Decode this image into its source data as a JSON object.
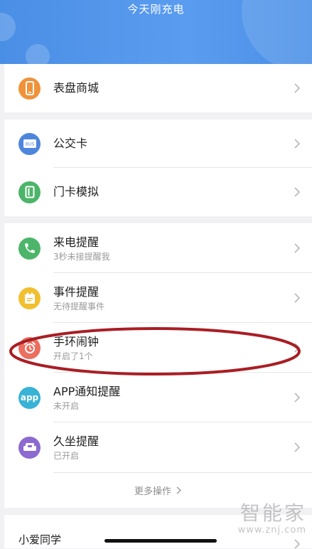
{
  "header": {
    "title": "今天刚充电"
  },
  "colors": {
    "header_bg": "#4a8fe6",
    "orange": "#f0923a",
    "blue": "#4d86dc",
    "green": "#4cb56a",
    "yellow": "#f2bf2f",
    "red": "#ec6e5f",
    "teal": "#38b3d6",
    "purple": "#8c6ad0",
    "annotation": "#a91e24"
  },
  "groups": [
    {
      "items": [
        {
          "label": "表盘商城",
          "icon": "watch-face-store-icon"
        }
      ]
    },
    {
      "items": [
        {
          "label": "公交卡",
          "icon": "bus-card-icon"
        },
        {
          "label": "门卡模拟",
          "icon": "door-card-icon"
        }
      ]
    },
    {
      "items": [
        {
          "label": "来电提醒",
          "sub": "3秒未接提醒我",
          "icon": "phone-icon"
        },
        {
          "label": "事件提醒",
          "sub": "无待提醒事件",
          "icon": "calendar-icon"
        },
        {
          "label": "手环闹钟",
          "sub": "开启了1个",
          "icon": "alarm-clock-icon"
        },
        {
          "label": "APP通知提醒",
          "sub": "未开启",
          "icon": "app-notification-icon",
          "icon_text": "app"
        },
        {
          "label": "久坐提醒",
          "sub": "已开启",
          "icon": "sofa-icon"
        }
      ],
      "more_label": "更多操作"
    }
  ],
  "bottom": {
    "label": "小爱同学"
  },
  "watermark": {
    "big": "智能家",
    "small": "www.znj.com"
  }
}
